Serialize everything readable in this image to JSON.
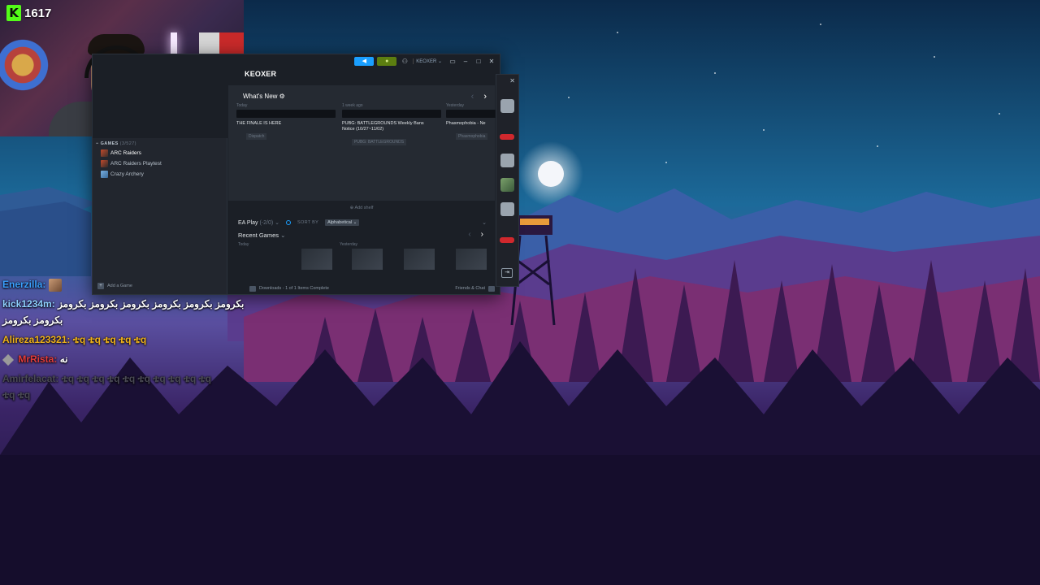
{
  "stream": {
    "viewer_count": "1617"
  },
  "steam": {
    "username": "KEOXER",
    "header_title": "KEOXER",
    "whats_new": {
      "title": "What's New",
      "items": [
        {
          "when": "Today",
          "headline": "THE FINALE IS HERE",
          "tag": "Dispatch"
        },
        {
          "when": "1 week ago",
          "headline": "PUBG: BATTLEGROUNDS Weekly Bans\nNotice (10/27~11/02)",
          "tag": "PUBG: BATTLEGROUNDS"
        },
        {
          "when": "Yesterday",
          "headline": "Phasmophobia - Ne",
          "tag": "Phasmophobia"
        }
      ]
    },
    "sidebar": {
      "section_title": "GAMES",
      "section_count": "(3/527)",
      "games": [
        {
          "label": "ARC Raiders",
          "icon": "arc-raiders-icon",
          "active": true
        },
        {
          "label": "ARC Raiders Playtest",
          "icon": "arc-raiders-playtest-icon",
          "active": false
        },
        {
          "label": "Crazy Archery",
          "icon": "crazy-archery-icon",
          "active": false
        }
      ],
      "add_game": "Add a Game"
    },
    "add_shelf": "Add shelf",
    "shelf": {
      "name": "EA Play",
      "count": "(-2/0)",
      "sort_by_label": "SORT BY",
      "sort_value": "Alphabetical"
    },
    "recent": {
      "title": "Recent Games",
      "col1_when": "Today",
      "col2_when": "Yesterday"
    },
    "status": {
      "downloads": "Downloads - 1 of 1 Items Complete",
      "friends_chat": "Friends & Chat"
    }
  },
  "chat": {
    "messages": [
      {
        "user": "Enerzilla:",
        "color": "#3aa0ff",
        "text": "",
        "emote": true
      },
      {
        "user": "kick1234m:",
        "color": "#8fd0ff",
        "text": "بکرومز بکرومز بکرومز بکرومز بکرومز بکرومز بکرومز بکرومز"
      },
      {
        "user": "Alireza123321:",
        "color": "#f0b21b",
        "text": "ቴq ቴq ቴq ቴq ቴq"
      },
      {
        "user": "MrRista:",
        "color": "#e23b3b",
        "text": "نه"
      },
      {
        "user": "Amirfelacat:",
        "color": "#4a4a55",
        "text": "ቴq ቴq ቴq ቴq ቴq ቴq ቴq ቴq ቴq ቴq ቴq ቴq"
      }
    ]
  }
}
